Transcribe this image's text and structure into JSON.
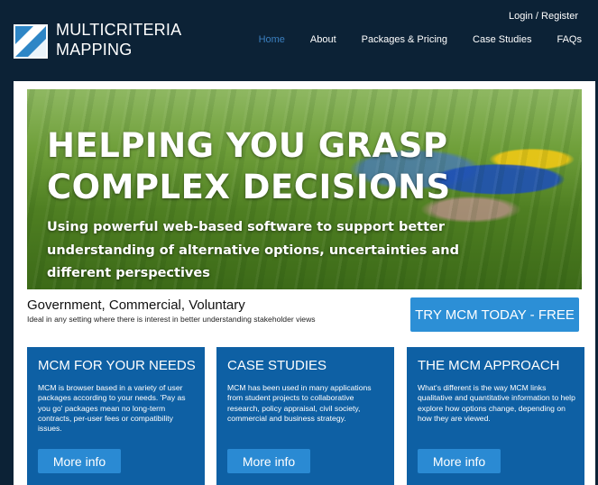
{
  "brand": {
    "line1": "MULTICRITERIA",
    "line2": "MAPPING",
    "logo": "mcm-logo-icon"
  },
  "header": {
    "login_label": "Login / Register",
    "nav": [
      {
        "label": "Home",
        "active": true
      },
      {
        "label": "About",
        "active": false
      },
      {
        "label": "Packages & Pricing",
        "active": false
      },
      {
        "label": "Case Studies",
        "active": false
      },
      {
        "label": "FAQs",
        "active": false
      }
    ]
  },
  "hero": {
    "headline_line1": "HELPING YOU GRASP",
    "headline_line2": "COMPLEX DECISIONS",
    "subtext": "Using powerful web-based software to support better understanding of alternative options, uncertainties and different perspectives"
  },
  "tagline": {
    "title": "Government, Commercial, Voluntary",
    "subtitle": "Ideal in any setting where there is interest in better understanding stakeholder views"
  },
  "cta": {
    "label": "TRY MCM TODAY - FREE"
  },
  "cards": [
    {
      "title": "MCM FOR YOUR NEEDS",
      "description": "MCM is browser based in a variety of user packages according to your needs. 'Pay as you go' packages mean no long-term contracts, per-user fees or compatibility issues.",
      "button": "More info"
    },
    {
      "title": "CASE STUDIES",
      "description": "MCM has been used in many applications from student projects to collaborative research, policy appraisal, civil society, commercial and business strategy.",
      "button": "More info"
    },
    {
      "title": "THE MCM APPROACH",
      "description": "What's different is the way MCM links qualitative and quantitative information to help explore how options change, depending on how they are viewed.",
      "button": "More info"
    }
  ],
  "colors": {
    "header_bg": "#0c2236",
    "accent": "#2c8fd6",
    "card_bg": "#0e60a4",
    "nav_active": "#3b7fbf"
  }
}
